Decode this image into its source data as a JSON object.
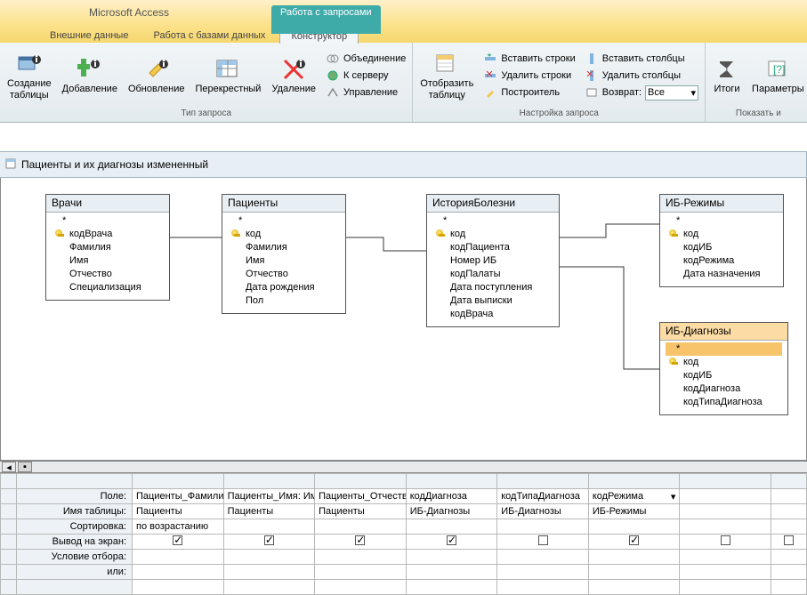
{
  "app": {
    "title": "Microsoft Access"
  },
  "context_tab_group": "Работа с запросами",
  "tabs": {
    "external": "Внешние данные",
    "dbtools": "Работа с базами данных",
    "design": "Конструктор"
  },
  "ribbon": {
    "type_group": "Тип запроса",
    "make_table": "Создание\nтаблицы",
    "append": "Добавление",
    "update": "Обновление",
    "crosstab": "Перекрестный",
    "delete": "Удаление",
    "union": "Объединение",
    "passthrough": "К серверу",
    "datadef": "Управление",
    "show_table": "Отобразить\nтаблицу",
    "setup_group": "Настройка запроса",
    "ins_rows": "Вставить строки",
    "del_rows": "Удалить строки",
    "builder": "Построитель",
    "ins_cols": "Вставить столбцы",
    "del_cols": "Удалить столбцы",
    "return_lbl": "Возврат:",
    "return_val": "Все",
    "totals": "Итоги",
    "params": "Параметры",
    "show_group": "Показать и"
  },
  "query_title": "Пациенты и их диагнозы измененный",
  "tables": {
    "doctors": {
      "title": "Врачи",
      "star": "*",
      "f1": "кодВрача",
      "f2": "Фамилия",
      "f3": "Имя",
      "f4": "Отчество",
      "f5": "Специализация"
    },
    "patients": {
      "title": "Пациенты",
      "star": "*",
      "f1": "код",
      "f2": "Фамилия",
      "f3": "Имя",
      "f4": "Отчество",
      "f5": "Дата рождения",
      "f6": "Пол"
    },
    "history": {
      "title": "ИсторияБолезни",
      "star": "*",
      "f1": "код",
      "f2": "кодПациента",
      "f3": "Номер ИБ",
      "f4": "кодПалаты",
      "f5": "Дата поступления",
      "f6": "Дата выписки",
      "f7": "кодВрача"
    },
    "regimes": {
      "title": "ИБ-Режимы",
      "star": "*",
      "f1": "код",
      "f2": "кодИБ",
      "f3": "кодРежима",
      "f4": "Дата назначения"
    },
    "diagnoses": {
      "title": "ИБ-Диагнозы",
      "star": "*",
      "f1": "код",
      "f2": "кодИБ",
      "f3": "кодДиагноза",
      "f4": "кодТипаДиагноза"
    }
  },
  "grid": {
    "labels": {
      "field": "Поле:",
      "table": "Имя таблицы:",
      "sort": "Сортировка:",
      "show": "Вывод на экран:",
      "criteria": "Условие отбора:",
      "or": "или:"
    },
    "cols": [
      {
        "field": "Пациенты_Фамилия:",
        "table": "Пациенты",
        "sort": "по возрастанию",
        "show": true
      },
      {
        "field": "Пациенты_Имя: Имя",
        "table": "Пациенты",
        "sort": "",
        "show": true
      },
      {
        "field": "Пациенты_Отчество",
        "table": "Пациенты",
        "sort": "",
        "show": true
      },
      {
        "field": "кодДиагноза",
        "table": "ИБ-Диагнозы",
        "sort": "",
        "show": true
      },
      {
        "field": "кодТипаДиагноза",
        "table": "ИБ-Диагнозы",
        "sort": "",
        "show": false
      },
      {
        "field": "кодРежима",
        "table": "ИБ-Режимы",
        "sort": "",
        "show": true
      },
      {
        "field": "",
        "table": "",
        "sort": "",
        "show": false
      }
    ]
  }
}
